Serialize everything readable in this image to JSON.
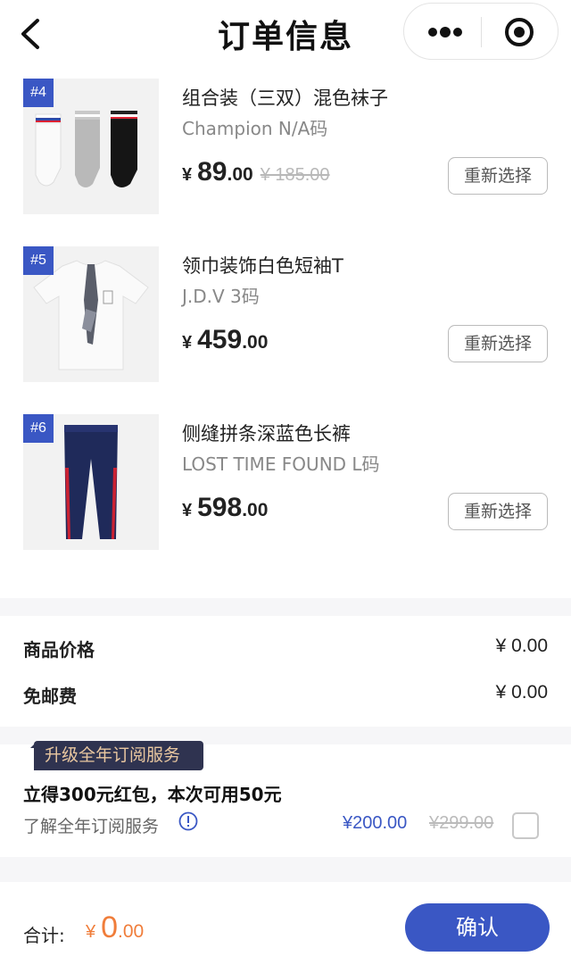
{
  "nav": {
    "title": "订单信息",
    "back_icon": "chevron-left-icon",
    "more_icon": "more-dots-icon",
    "close_icon": "target-circle-icon"
  },
  "items": [
    {
      "badge": "#4",
      "name": "组合装（三双）混色袜子",
      "spec": "Champion N/A码",
      "price_yen": "¥",
      "price_int": "89",
      "price_dec": ".00",
      "original_price": "¥ 185.00",
      "reselect_label": "重新选择"
    },
    {
      "badge": "#5",
      "name": "领巾装饰白色短袖T",
      "spec": "J.D.V 3码",
      "price_yen": "¥",
      "price_int": "459",
      "price_dec": ".00",
      "original_price": "",
      "reselect_label": "重新选择"
    },
    {
      "badge": "#6",
      "name": "侧缝拼条深蓝色长裤",
      "spec": "LOST TIME FOUND L码",
      "price_yen": "¥",
      "price_int": "598",
      "price_dec": ".00",
      "original_price": "",
      "reselect_label": "重新选择"
    }
  ],
  "summary": {
    "goods_price_label": "商品价格",
    "goods_price_value": "¥ 0.00",
    "shipping_label": "免邮费",
    "shipping_value": "¥ 0.00"
  },
  "subscription": {
    "tag": "升级全年订阅服务",
    "title": "立得300元红包，本次可用50元",
    "learn_more": "了解全年订阅服务",
    "price": "¥200.00",
    "original_price": "¥299.00",
    "checked": false
  },
  "footer": {
    "total_label": "合计:",
    "total_yen": "¥",
    "total_int": "0",
    "total_dec": ".00",
    "confirm_label": "确认"
  },
  "colors": {
    "accent": "#3a57c4",
    "total": "#f07d3a",
    "tag_bg": "#2f3350",
    "tag_text": "#e9c7a0"
  }
}
